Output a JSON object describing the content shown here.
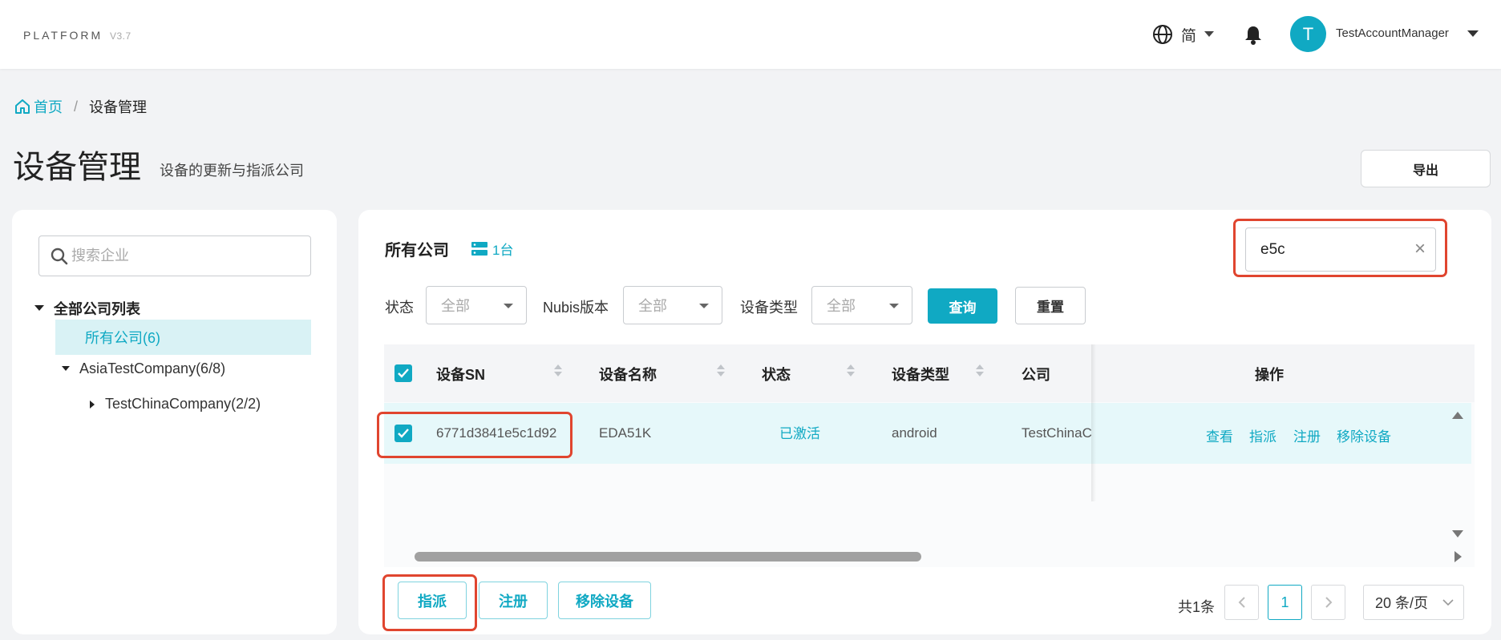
{
  "header": {
    "brand": "PLATFORM",
    "version": "V3.7",
    "language": "简",
    "user_initial": "T",
    "username": "TestAccountManager"
  },
  "breadcrumb": {
    "home": "首页",
    "separator": "/",
    "current": "设备管理"
  },
  "page": {
    "title": "设备管理",
    "subtitle": "设备的更新与指派公司",
    "export_label": "导出"
  },
  "sidebar": {
    "search_placeholder": "搜索企业",
    "tree": {
      "root": "全部公司列表",
      "selected": "所有公司(6)",
      "asia": "AsiaTestCompany(6/8)",
      "china": "TestChinaCompany(2/2)"
    }
  },
  "main": {
    "title": "所有公司",
    "device_count": "1台",
    "sn_search_value": "e5c",
    "filters": {
      "status_label": "状态",
      "status_value": "全部",
      "nubis_label": "Nubis版本",
      "nubis_value": "全部",
      "type_label": "设备类型",
      "type_value": "全部"
    },
    "query_label": "查询",
    "reset_label": "重置"
  },
  "table": {
    "headers": {
      "sn": "设备SN",
      "name": "设备名称",
      "status": "状态",
      "type": "设备类型",
      "company": "公司",
      "actions": "操作"
    },
    "rows": [
      {
        "sn": "6771d3841e5c1d92",
        "name": "EDA51K",
        "status": "已激活",
        "type": "android",
        "company": "TestChinaCom",
        "actions": [
          "查看",
          "指派",
          "注册",
          "移除设备"
        ]
      }
    ]
  },
  "bulk_actions": {
    "assign": "指派",
    "register": "注册",
    "remove": "移除设备"
  },
  "pagination": {
    "total": "共1条",
    "current_page": "1",
    "page_size": "20 条/页"
  },
  "colors": {
    "accent": "#10a9c3",
    "highlight": "#e0452f",
    "row_selected": "#e6f8fa"
  }
}
